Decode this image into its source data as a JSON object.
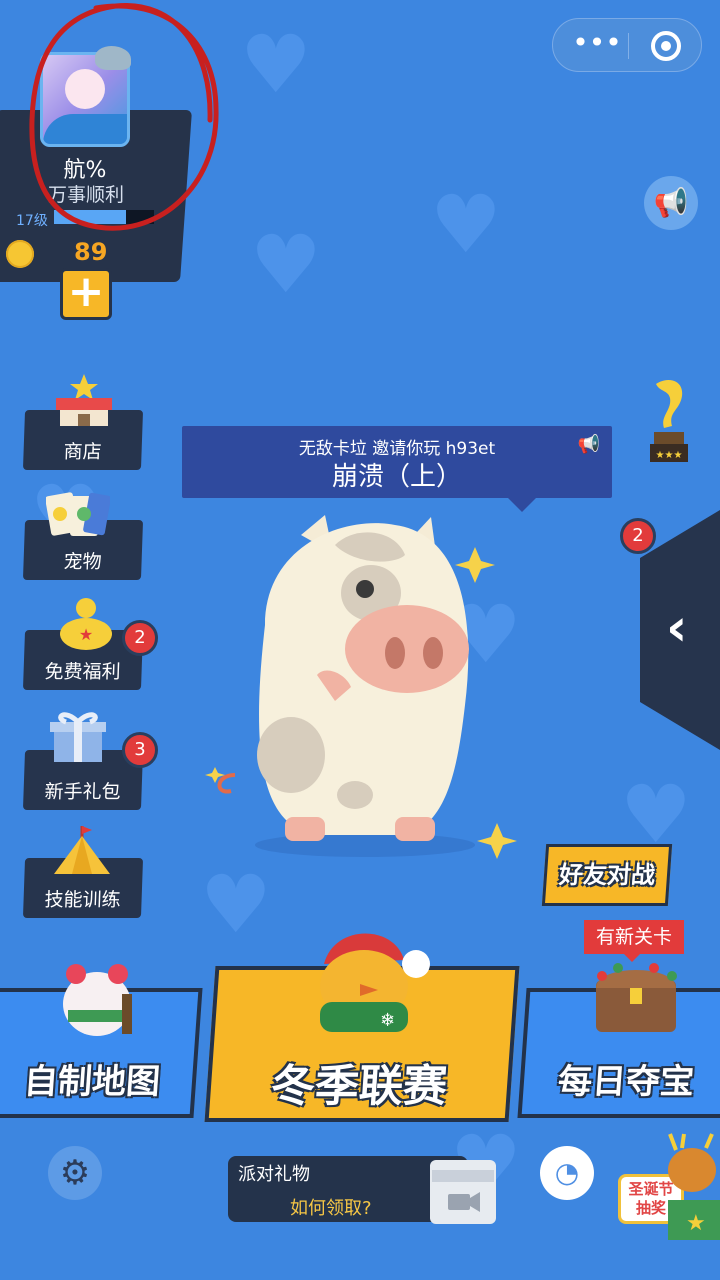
{
  "profile": {
    "name": "航%",
    "motto": "万事顺利",
    "level": "17级",
    "level_progress": 0.72,
    "coins": "89",
    "plus_label": "+"
  },
  "top_capsule": {
    "more_icon": "more-dots-icon",
    "close_icon": "target-ring-icon"
  },
  "left_menu": [
    {
      "label": "商店",
      "icon": "shop-icon"
    },
    {
      "label": "宠物",
      "icon": "pet-cards-icon"
    },
    {
      "label": "免费福利",
      "icon": "piggy-bank-icon",
      "badge": "2"
    },
    {
      "label": "新手礼包",
      "icon": "gift-box-icon",
      "badge": "3"
    },
    {
      "label": "技能训练",
      "icon": "tent-icon"
    }
  ],
  "speech": {
    "line1": "无敌卡垃 邀请你玩 h93et",
    "line2": "崩溃（上）"
  },
  "drawer_badge": "2",
  "friend_battle": "好友对战",
  "new_level_tag": "有新关卡",
  "big_buttons": {
    "custom_map": "自制地图",
    "winter_league": "冬季联赛",
    "daily_treasure": "每日夺宝"
  },
  "bottom": {
    "party_title": "派对礼物",
    "party_link": "如何领取?",
    "xmas_line1": "圣诞节",
    "xmas_line2": "抽奖"
  },
  "colors": {
    "background": "#3d86e0",
    "panel": "#26344d",
    "accent_yellow": "#f7b727",
    "badge_red": "#e23b3b"
  }
}
